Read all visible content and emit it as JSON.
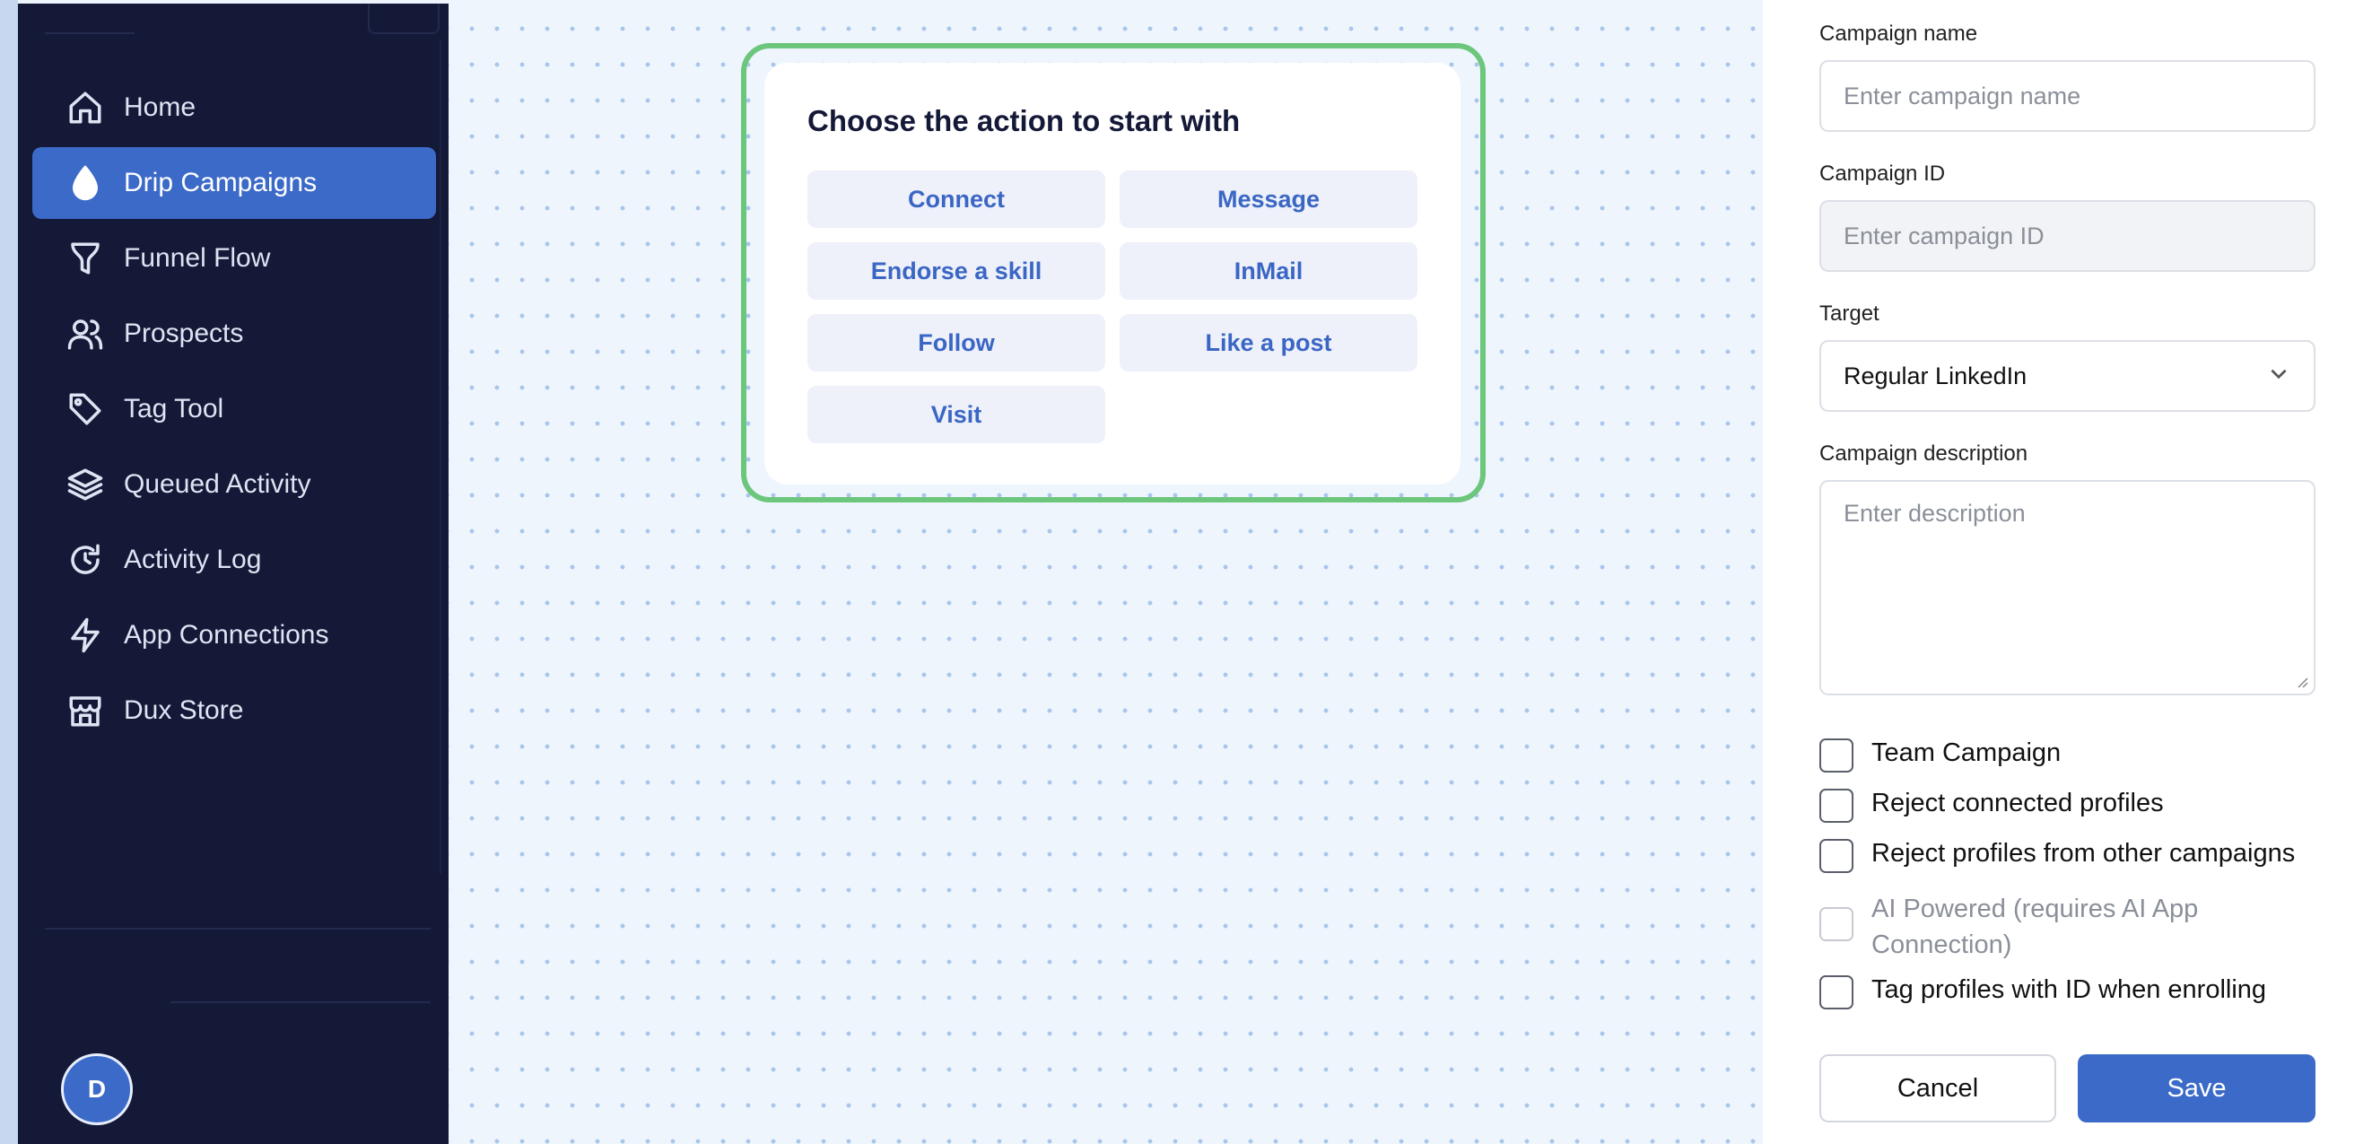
{
  "sidebar": {
    "items": [
      {
        "label": "Home",
        "icon": "home-icon"
      },
      {
        "label": "Drip Campaigns",
        "icon": "drop-icon",
        "active": true
      },
      {
        "label": "Funnel Flow",
        "icon": "funnel-icon"
      },
      {
        "label": "Prospects",
        "icon": "users-icon"
      },
      {
        "label": "Tag Tool",
        "icon": "tag-icon"
      },
      {
        "label": "Queued Activity",
        "icon": "layers-icon"
      },
      {
        "label": "Activity Log",
        "icon": "history-icon"
      },
      {
        "label": "App Connections",
        "icon": "lightning-icon"
      },
      {
        "label": "Dux Store",
        "icon": "store-icon"
      }
    ],
    "avatar_initial": "D"
  },
  "canvas": {
    "action_card": {
      "title": "Choose the action to start with",
      "actions": [
        "Connect",
        "Message",
        "Endorse a skill",
        "InMail",
        "Follow",
        "Like a post",
        "Visit"
      ]
    }
  },
  "panel": {
    "campaign_name": {
      "label": "Campaign name",
      "placeholder": "Enter campaign name"
    },
    "campaign_id": {
      "label": "Campaign ID",
      "placeholder": "Enter campaign ID"
    },
    "target": {
      "label": "Target",
      "value": "Regular LinkedIn"
    },
    "description": {
      "label": "Campaign description",
      "placeholder": "Enter description"
    },
    "checkboxes": [
      {
        "label": "Team Campaign",
        "checked": false
      },
      {
        "label": "Reject connected profiles",
        "checked": false
      },
      {
        "label": "Reject profiles from other campaigns",
        "checked": false
      },
      {
        "label": "AI Powered (requires AI App Connection)",
        "checked": false,
        "disabled": true
      },
      {
        "label": "Tag profiles with ID when enrolling",
        "checked": false
      }
    ],
    "cancel_label": "Cancel",
    "save_label": "Save"
  },
  "colors": {
    "sidebar_bg": "#141938",
    "accent": "#3c6ac8",
    "card_outline": "#6cc67c"
  }
}
